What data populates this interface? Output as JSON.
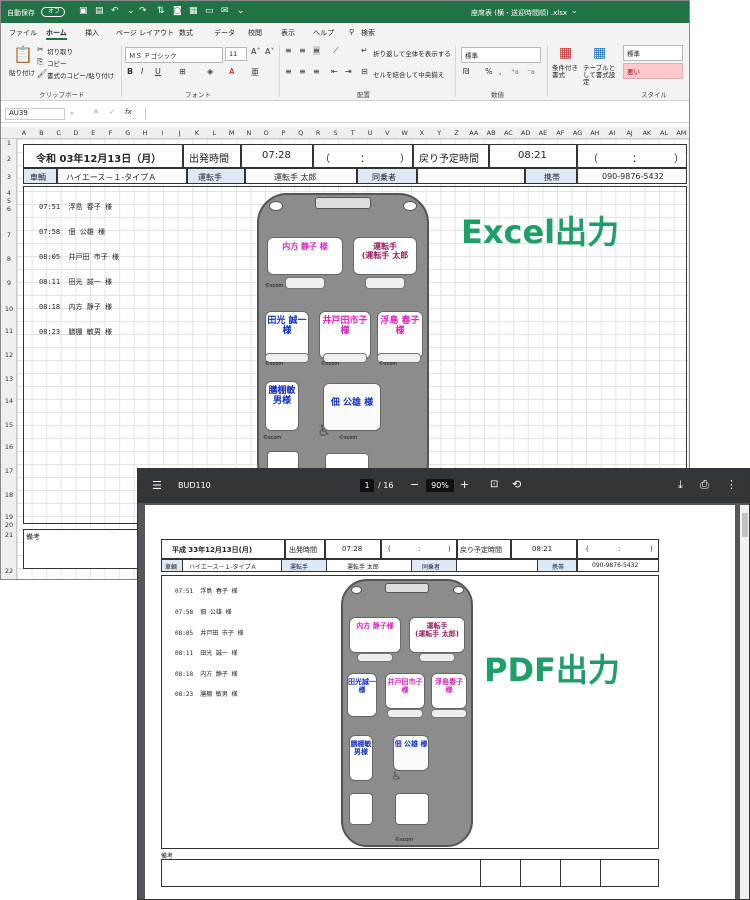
{
  "excel": {
    "autosave_label": "自動保存",
    "autosave_state": "オフ",
    "window_title": "座席表 (横・送迎時間順) .xlsx",
    "tabs": [
      "ファイル",
      "ホーム",
      "挿入",
      "ページ レイアウト",
      "数式",
      "データ",
      "校閲",
      "表示",
      "ヘルプ"
    ],
    "search_label": "検索",
    "ribbon": {
      "paste": "貼り付け",
      "cut": "切り取り",
      "copy": "コピー",
      "format_painter": "書式のコピー/貼り付け",
      "clipboard": "クリップボード",
      "font_name": "ＭＳ Ｐゴシック",
      "font_size": "11",
      "font_group": "フォント",
      "wrap_text": "折り返して全体を表示する",
      "merge_center": "セルを結合して中央揃え",
      "alignment_group": "配置",
      "number_format": "標準",
      "number_group": "数値",
      "conditional_format": "条件付き書式",
      "table_format": "テーブルとして書式設定",
      "style_normal": "標準",
      "style_bad": "悪い",
      "style_group": "スタイル"
    },
    "name_box": "AU39",
    "fx": "fx",
    "columns": [
      "A",
      "B",
      "C",
      "D",
      "E",
      "F",
      "G",
      "H",
      "I",
      "J",
      "K",
      "L",
      "M",
      "N",
      "O",
      "P",
      "Q",
      "R",
      "S",
      "T",
      "U",
      "V",
      "W",
      "X",
      "Y",
      "Z",
      "AA",
      "AB",
      "AC",
      "AD",
      "AE",
      "AF",
      "AG",
      "AH",
      "AI",
      "AJ",
      "AK",
      "AL",
      "AM"
    ],
    "rows": [
      "1",
      "2",
      "3",
      "4",
      "5",
      "6",
      "7",
      "8",
      "9",
      "10",
      "11",
      "12",
      "13",
      "14",
      "15",
      "16",
      "17",
      "18",
      "19",
      "20",
      "21",
      "22"
    ],
    "sheet": {
      "date": "令和 03年12月13日（月）",
      "depart_label": "出発時間",
      "depart_time": "07:28",
      "paren_open": "（",
      "colon": "：",
      "paren_close": "）",
      "return_label": "戻り予定時間",
      "return_time": "08:21",
      "vehicle_label": "車輌",
      "vehicle": "ハイエース－１-タイプＡ",
      "driver_label": "運転手",
      "driver": "運転手 太郎",
      "companion_label": "同乗者",
      "phone_label": "携帯",
      "phone": "090-9876-5432",
      "notes_label": "備考"
    },
    "passengers": [
      {
        "time": "07:51",
        "name": "浮島 春子 様"
      },
      {
        "time": "07:58",
        "name": "佃 公雄 様"
      },
      {
        "time": "08:05",
        "name": "井戸田 市子 様"
      },
      {
        "time": "08:11",
        "name": "田光 誠一 様"
      },
      {
        "time": "08:18",
        "name": "内方 静子 様"
      },
      {
        "time": "08:23",
        "name": "膳棚 敏男 様"
      }
    ],
    "seats": {
      "s1": "内方 静子 様",
      "driver_l1": "運転手",
      "driver_l2": "(運転手 太郎",
      "s3": "田光 誠一様",
      "s4": "井戸田市子 様",
      "s5": "浮島 春子 様",
      "s6": "膳棚敏男様",
      "s7": "佃 公雄 様"
    },
    "scom": "©scom",
    "overlay_label": "Excel出力"
  },
  "pdf": {
    "doc_title": "BUD110",
    "page_current": "1",
    "page_total": "/ 16",
    "zoom": "90%",
    "minus": "−",
    "plus": "+",
    "overlay_label": "PDF出力",
    "sheet": {
      "date": "平成 33年12月13日(月)",
      "depart_label": "出発時間",
      "depart_time": "07:28",
      "paren_open": "(",
      "colon": ":",
      "paren_close": ")",
      "return_label": "戻り予定時間",
      "return_time": "08:21",
      "vehicle_label": "車輌",
      "vehicle": "ハイエース－１-タイプＡ",
      "driver_label": "運転手",
      "driver": "運転手 太郎",
      "companion_label": "同乗者",
      "phone_label": "携帯",
      "phone": "090-9876-5432",
      "notes_label": "備考"
    },
    "passengers": [
      {
        "time": "07:51",
        "name": "浮島 春子 様"
      },
      {
        "time": "07:58",
        "name": "佃 公雄 様"
      },
      {
        "time": "08:05",
        "name": "井戸田 市子 様"
      },
      {
        "time": "08:11",
        "name": "田光 誠一 様"
      },
      {
        "time": "08:18",
        "name": "内方 静子 様"
      },
      {
        "time": "08:23",
        "name": "膳棚 敏男 様"
      }
    ],
    "seats": {
      "s1": "内方 静子様",
      "driver_l1": "運転手",
      "driver_l2": "(運転手 太郎)",
      "s3": "田光誠一様",
      "s4": "井戸田市子 様",
      "s5": "浮島春子様",
      "s6": "膳棚敏男様",
      "s7": "佃 公雄 様"
    },
    "scom": "©scom"
  },
  "colors": {
    "excel_green": "#217346",
    "magenta": "#e020c0",
    "blue": "#1530c8",
    "label_green": "#1e9f6a"
  }
}
